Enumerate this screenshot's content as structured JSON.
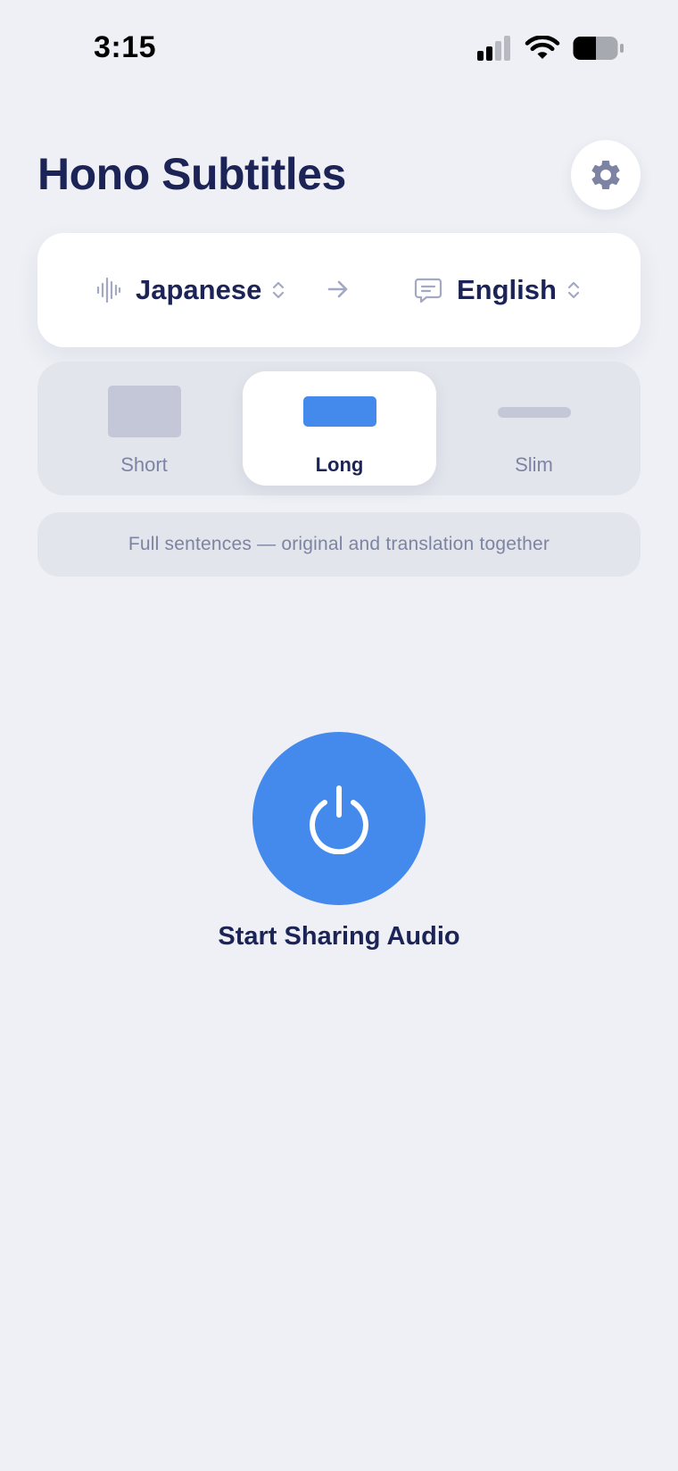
{
  "status": {
    "time": "3:15"
  },
  "header": {
    "title": "Hono Subtitles"
  },
  "languages": {
    "source": "Japanese",
    "target": "English"
  },
  "modes": [
    {
      "label": "Short",
      "selected": false
    },
    {
      "label": "Long",
      "selected": true
    },
    {
      "label": "Slim",
      "selected": false
    }
  ],
  "description": "Full sentences — original and translation together",
  "action": {
    "label": "Start Sharing Audio"
  },
  "colors": {
    "accent": "#438AEC",
    "text": "#1C2457",
    "muted": "#7D84A3",
    "background": "#EEF0F5"
  }
}
